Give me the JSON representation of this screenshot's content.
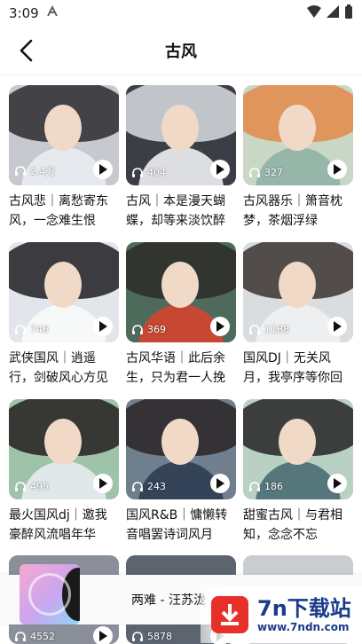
{
  "status": {
    "time": "3:09"
  },
  "header": {
    "title": "古风"
  },
  "cards": [
    {
      "count": "2.4万",
      "title": "古风悲｜离愁寄东风，一念难生恨",
      "bg": "#c7c9cf",
      "hair": "#2c2a2e",
      "robe": "#e9edf2"
    },
    {
      "count": "404",
      "title": "古风｜本是漫天蝴蝶，却等来淡饮醉",
      "bg": "#3b3e45",
      "hair": "#d9dde2",
      "robe": "#f0f0f2"
    },
    {
      "count": "327",
      "title": "古风器乐｜箫音枕梦，茶烟浮绿",
      "bg": "#c8d8c4",
      "hair": "#e38a4a",
      "robe": "#8fb2a6"
    },
    {
      "count": "746",
      "title": "武侠国风｜逍遥行，剑破风心方见",
      "bg": "#e2e5ea",
      "hair": "#1e1e22",
      "robe": "#fafafa"
    },
    {
      "count": "369",
      "title": "古风华语｜此后余生，只为君一人挽",
      "bg": "#4e6a5a",
      "hair": "#2d2a28",
      "robe": "#d4452e"
    },
    {
      "count": "1188",
      "title": "国风DJ｜无关风月，我亭序等你回",
      "bg": "#d9dde0",
      "hair": "#3a3230",
      "robe": "#eef1f2"
    },
    {
      "count": "495",
      "title": "最火国风dj｜邀我豪醉风流唱年华",
      "bg": "#9fc3a8",
      "hair": "#241f1f",
      "robe": "#e8ecef"
    },
    {
      "count": "243",
      "title": "国风R&B｜慵懒转音唱罢诗词风月",
      "bg": "#6f7f8e",
      "hair": "#2a2524",
      "robe": "#2f3d52"
    },
    {
      "count": "186",
      "title": "甜蜜古风｜与君相知，念念不忘",
      "bg": "#b9d1c2",
      "hair": "#262426",
      "robe": "#4a6b72"
    }
  ],
  "partial_cards": [
    {
      "count": "4552"
    },
    {
      "count": "5878"
    }
  ],
  "player": {
    "title": "两难 - 汪苏泷"
  },
  "watermark": {
    "main": "7n下载站",
    "sub": "www.7ndn.com"
  }
}
